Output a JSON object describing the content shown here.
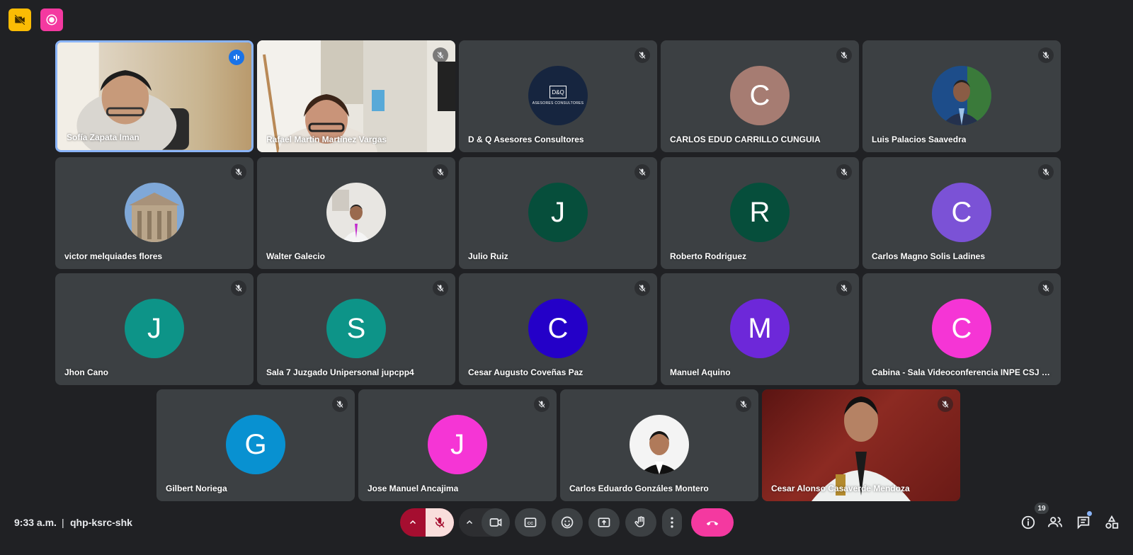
{
  "tiles": [
    {
      "name": "Sofía Zapata Iman",
      "type": "video"
    },
    {
      "name": "Rafael Martin Martinez Vargas",
      "type": "video"
    },
    {
      "name": "D & Q Asesores Consultores",
      "type": "logo",
      "logo_text": "D&Q",
      "logo_sub": "ASESORES CONSULTORES",
      "color": "#16253f"
    },
    {
      "name": "CARLOS EDUD CARRILLO CUNGUIA",
      "type": "letter",
      "letter": "C",
      "color": "#a67c72"
    },
    {
      "name": "Luis Palacios Saavedra",
      "type": "photo"
    },
    {
      "name": "victor melquiades flores",
      "type": "photo"
    },
    {
      "name": "Walter Galecio",
      "type": "photo"
    },
    {
      "name": "Julio Ruiz",
      "type": "letter",
      "letter": "J",
      "color": "#064e3b"
    },
    {
      "name": "Roberto Rodriguez",
      "type": "letter",
      "letter": "R",
      "color": "#064e3b"
    },
    {
      "name": "Carlos Magno Solis Ladines",
      "type": "letter",
      "letter": "C",
      "color": "#7b52d6"
    },
    {
      "name": "Jhon Cano",
      "type": "letter",
      "letter": "J",
      "color": "#0d9488"
    },
    {
      "name": "Sala 7 Juzgado Unipersonal jupcpp4",
      "type": "letter",
      "letter": "S",
      "color": "#0d9488"
    },
    {
      "name": "Cesar Augusto Coveñas Paz",
      "type": "letter",
      "letter": "C",
      "color": "#2400c8"
    },
    {
      "name": "Manuel Aquino",
      "type": "letter",
      "letter": "M",
      "color": "#6d28d9"
    },
    {
      "name": "Cabina - Sala Videoconferencia INPE CSJ Pi...",
      "type": "letter",
      "letter": "C",
      "color": "#f535d5"
    },
    {
      "name": "Gilbert Noriega",
      "type": "letter",
      "letter": "G",
      "color": "#0891d1"
    },
    {
      "name": "Jose Manuel Ancajima",
      "type": "letter",
      "letter": "J",
      "color": "#f535d5"
    },
    {
      "name": "Carlos Eduardo Gonzáles Montero",
      "type": "photo"
    },
    {
      "name": "Cesar Alonso Casaverde Mendoza",
      "type": "video"
    }
  ],
  "bottom": {
    "time": "9:33 a.m.",
    "separator": "|",
    "meeting_code": "qhp-ksrc-shk",
    "people_count": "19"
  },
  "colors": {
    "background": "#202124",
    "tile": "#3c4043",
    "end_call": "#f439a0",
    "mic_off_bg": "#f9dedc",
    "active_border": "#8ab4f8"
  }
}
